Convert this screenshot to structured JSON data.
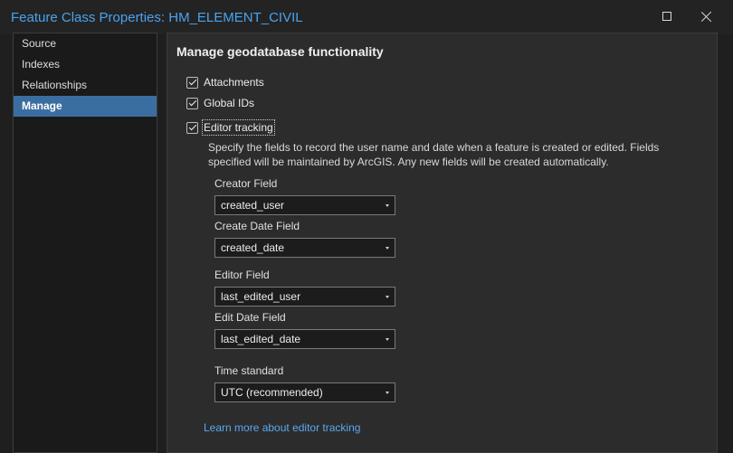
{
  "window": {
    "title": "Feature Class Properties: HM_ELEMENT_CIVIL"
  },
  "sidebar": {
    "items": [
      {
        "label": "Source",
        "selected": false
      },
      {
        "label": "Indexes",
        "selected": false
      },
      {
        "label": "Relationships",
        "selected": false
      },
      {
        "label": "Manage",
        "selected": true
      }
    ]
  },
  "main": {
    "title": "Manage geodatabase functionality",
    "options": [
      {
        "label": "Attachments",
        "checked": true
      },
      {
        "label": "Global IDs",
        "checked": true
      },
      {
        "label": "Editor tracking",
        "checked": true
      }
    ],
    "editor_tracking": {
      "description": "Specify the fields to record the user name and date when a feature is created or edited. Fields specified will be maintained by ArcGIS. Any new fields will be created automatically.",
      "fields": [
        {
          "label": "Creator Field",
          "value": "created_user"
        },
        {
          "label": "Create Date Field",
          "value": "created_date"
        },
        {
          "label": "Editor Field",
          "value": "last_edited_user"
        },
        {
          "label": "Edit Date Field",
          "value": "last_edited_date"
        },
        {
          "label": "Time standard",
          "value": "UTC (recommended)"
        }
      ]
    },
    "link_text": "Learn more about editor tracking"
  },
  "colors": {
    "accent": "#4aa3ef",
    "selection": "#3b6ea0",
    "link": "#5aa9f0",
    "background": "#2c2c2c"
  }
}
